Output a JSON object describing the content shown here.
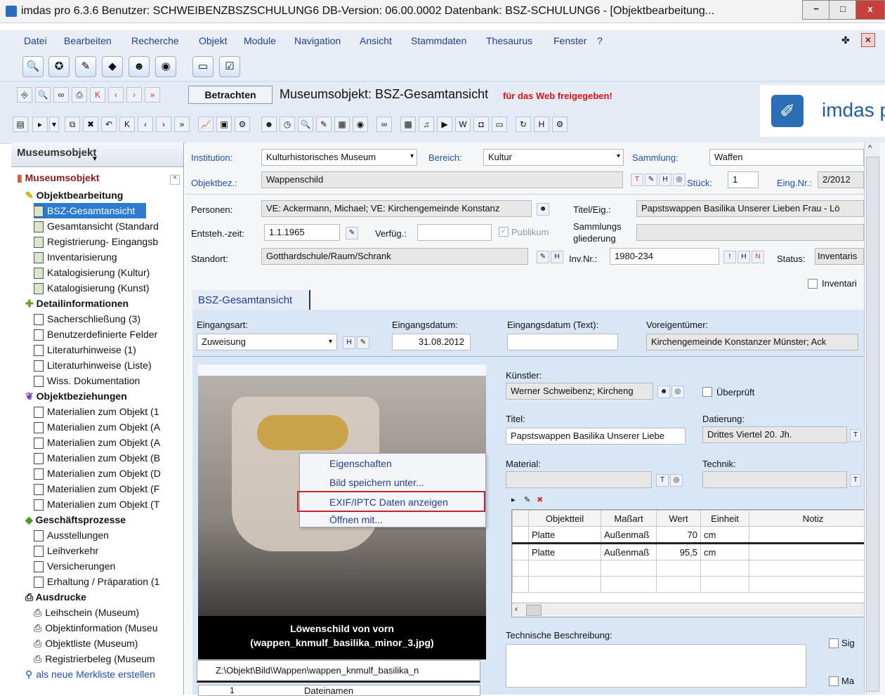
{
  "window": {
    "title": "imdas pro 6.3.6  Benutzer: SCHWEIBENZBSZSCHULUNG6   DB-Version: 06.00.0002   Datenbank: BSZ-SCHULUNG6 - [Objektbearbeitung..."
  },
  "menu": [
    "Datei",
    "Bearbeiten",
    "Recherche",
    "Objekt",
    "Module",
    "Navigation",
    "Ansicht",
    "Stammdaten",
    "Thesaurus",
    "Fenster",
    "?"
  ],
  "toolbar": {
    "view_button": "Betrachten",
    "heading": "Museumsobjekt: BSZ-Gesamtansicht",
    "web_notice": "für das Web freigegeben!",
    "logo": "imdas pr"
  },
  "sidebar": {
    "dropdown": "Museumsobjekt",
    "root": "Museumsobjekt",
    "groups": [
      {
        "title": "Objektbearbeitung",
        "items": [
          "BSZ-Gesamtansicht",
          "Gesamtansicht (Standard",
          "Registrierung- Eingangsb",
          "Inventarisierung",
          "Katalogisierung (Kultur)",
          "Katalogisierung (Kunst)"
        ]
      },
      {
        "title": "Detailinformationen",
        "items": [
          "Sacherschließung (3)",
          "Benutzerdefinierte Felder",
          "Literaturhinweise (1)",
          "Literaturhinweise (Liste)",
          "Wiss. Dokumentation"
        ]
      },
      {
        "title": "Objektbeziehungen",
        "items": [
          "Materialien zum Objekt (1",
          "Materialien zum Objekt (A",
          "Materialien zum Objekt (A",
          "Materialien zum Objekt (B",
          "Materialien zum Objekt (D",
          "Materialien zum Objekt (F",
          "Materialien zum Objekt (T"
        ]
      },
      {
        "title": "Geschäftsprozesse",
        "items": [
          "Ausstellungen",
          "Leihverkehr",
          "Versicherungen",
          "Erhaltung / Präparation (1"
        ]
      },
      {
        "title": "Ausdrucke",
        "items": [
          "Leihschein (Museum)",
          "Objektinformation (Museu",
          "Objektliste (Museum)",
          "Registrierbeleg (Museum"
        ]
      }
    ],
    "bottom_link": "als neue Merkliste erstellen"
  },
  "form": {
    "institution_label": "Institution:",
    "institution": "Kulturhistorisches Museum",
    "bereich_label": "Bereich:",
    "bereich": "Kultur",
    "sammlung_label": "Sammlung:",
    "sammlung": "Waffen",
    "objektbez_label": "Objektbez.:",
    "objektbez": "Wappenschild",
    "stueck_label": "Stück:",
    "stueck": "1",
    "eingnr_label": "Eing.Nr.:",
    "eingnr": "2/2012",
    "personen_label": "Personen:",
    "personen": "VE: Ackermann, Michael; VE: Kirchengemeinde Konstanz",
    "titel_eig_label": "Titel/Eig.:",
    "titel_eig": "Papstswappen Basilika Unserer Lieben Frau - Lö",
    "entsteh_label": "Entsteh.-zeit:",
    "entsteh": "1.1.1965",
    "verfueg_label": "Verfüg.:",
    "verfueg": "",
    "publikum_label": "Publikum",
    "sammlungsgl_label1": "Sammlungs",
    "sammlungsgl_label2": "gliederung",
    "sammlungsgl": "",
    "standort_label": "Standort:",
    "standort": "Gotthardschule/Raum/Schrank",
    "invnr_label": "Inv.Nr.:",
    "invnr": "1980-234",
    "status_label": "Status:",
    "status": "Inventaris",
    "inventar_check": "Inventari"
  },
  "tab": {
    "label": "BSZ-Gesamtansicht"
  },
  "detail": {
    "eingangsart_label": "Eingangsart:",
    "eingangsart": "Zuweisung",
    "eingangsdatum_label": "Eingangsdatum:",
    "eingangsdatum": "31.08.2012",
    "eingangsdatum_text_label": "Eingangsdatum (Text):",
    "eingangsdatum_text": "",
    "voreigentuemer_label": "Voreigentümer:",
    "voreigentuemer": "Kirchengemeinde Konstanzer Münster; Ack",
    "kuenstler_label": "Künstler:",
    "kuenstler": "Werner Schweibenz; Kircheng",
    "ueberprueft_label": "Überprüft",
    "titel_label": "Titel:",
    "titel": "Papstswappen Basilika Unserer Liebe",
    "datierung_label": "Datierung:",
    "datierung": "Drittes Viertel 20. Jh.",
    "material_label": "Material:",
    "material": "",
    "technik_label": "Technik:",
    "technik": "",
    "techbeschr_label": "Technische Beschreibung:",
    "sig_label": "Sig",
    "ma_label": "Ma"
  },
  "image": {
    "caption1": "Löwenschild von vorn",
    "caption2": "(wappen_knmulf_basilika_minor_3.jpg)"
  },
  "context_menu": [
    "Eigenschaften",
    "Bild speichern unter...",
    "EXIF/IPTC Daten anzeigen",
    "Öffnen mit..."
  ],
  "files": {
    "count": "1",
    "header": "Dateinamen",
    "row": "Z:\\Objekt\\Bild\\Wappen\\wappen_knmulf_basilika_n"
  },
  "measures": {
    "headers": [
      "Objektteil",
      "Maßart",
      "Wert",
      "Einheit",
      "Notiz"
    ],
    "rows": [
      [
        "Platte",
        "Außenmaß",
        "70",
        "cm",
        ""
      ],
      [
        "Platte",
        "Außenmaß",
        "95,5",
        "cm",
        ""
      ]
    ]
  }
}
